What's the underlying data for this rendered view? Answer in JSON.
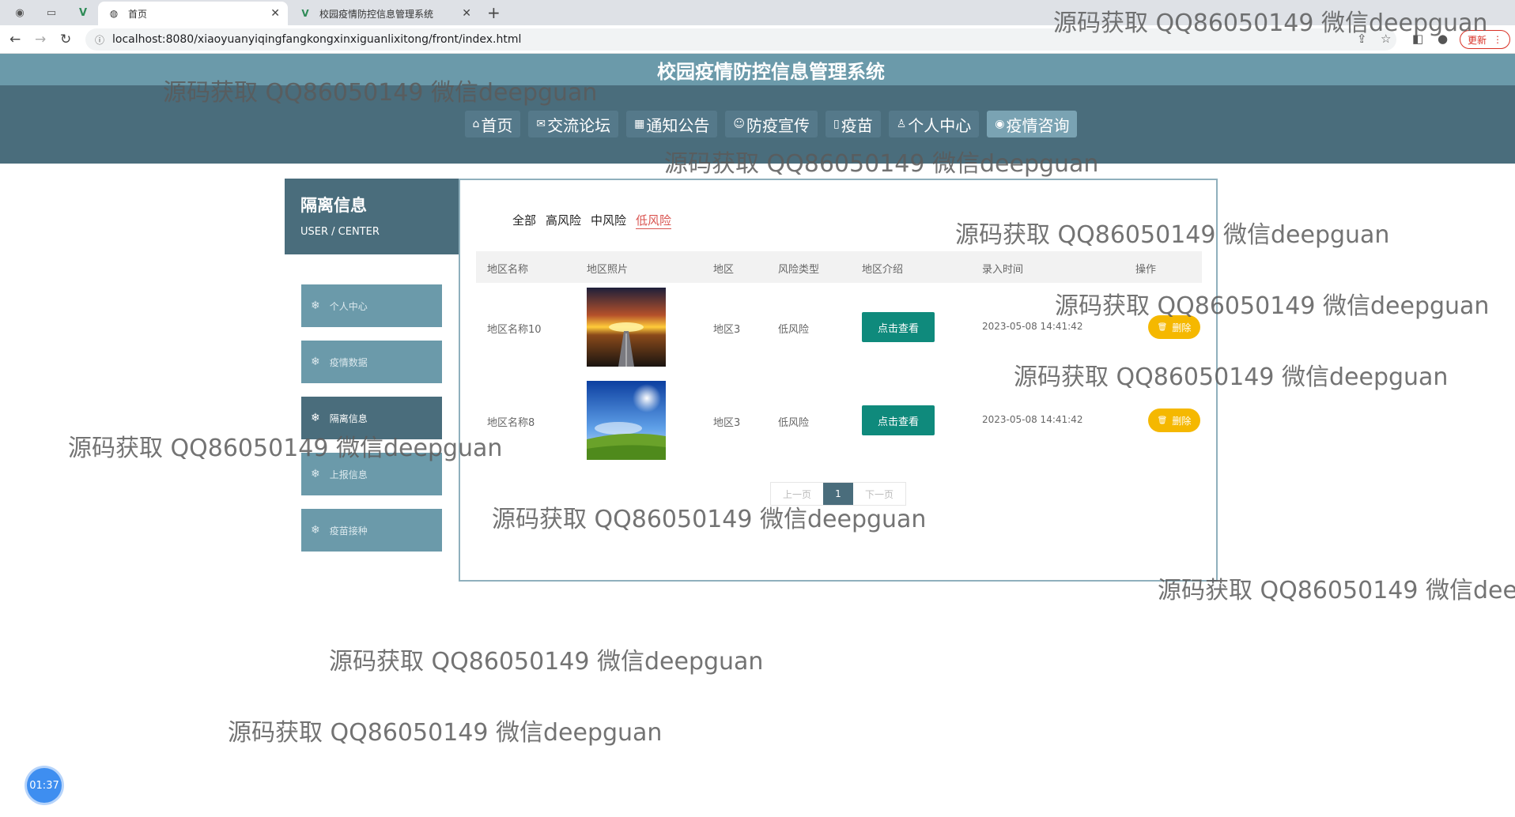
{
  "browser": {
    "tabs": [
      {
        "title": "首页"
      },
      {
        "title": "校园疫情防控信息管理系统"
      }
    ],
    "url": "localhost:8080/xiaoyuanyiqingfangkongxinxiguanlixitong/front/index.html",
    "update_label": "更新"
  },
  "site": {
    "title": "校园疫情防控信息管理系统",
    "nav": [
      {
        "label": "首页",
        "icon": "home-icon"
      },
      {
        "label": "交流论坛",
        "icon": "mail-icon"
      },
      {
        "label": "通知公告",
        "icon": "calendar-icon"
      },
      {
        "label": "防疫宣传",
        "icon": "smile-icon"
      },
      {
        "label": "疫苗",
        "icon": "document-icon"
      },
      {
        "label": "个人中心",
        "icon": "user-icon"
      },
      {
        "label": "疫情咨询",
        "icon": "globe-icon"
      }
    ],
    "active_nav": "疫情咨询"
  },
  "sidebar": {
    "heading": "隔离信息",
    "subheading": "USER / CENTER",
    "items": [
      {
        "label": "个人中心"
      },
      {
        "label": "疫情数据"
      },
      {
        "label": "隔离信息"
      },
      {
        "label": "上报信息"
      },
      {
        "label": "疫苗接种"
      }
    ],
    "active_item": "隔离信息"
  },
  "content": {
    "filters": [
      "全部",
      "高风险",
      "中风险",
      "低风险"
    ],
    "active_filter": "低风险",
    "columns": [
      "地区名称",
      "地区照片",
      "地区",
      "风险类型",
      "地区介绍",
      "录入时间",
      "操作"
    ],
    "rows": [
      {
        "name": "地区名称10",
        "photo": "sunset-road",
        "region": "地区3",
        "risk": "低风险",
        "intro_btn": "点击查看",
        "time": "2023-05-08 14:41:42",
        "delete_btn": "删除"
      },
      {
        "name": "地区名称8",
        "photo": "sunny-field",
        "region": "地区3",
        "risk": "低风险",
        "intro_btn": "点击查看",
        "time": "2023-05-08 14:41:42",
        "delete_btn": "删除"
      }
    ],
    "pager": {
      "prev": "上一页",
      "current": "1",
      "next": "下一页"
    }
  },
  "watermark": "源码获取 QQ86050149 微信deepguan",
  "timer": "01:37",
  "colors": {
    "header": "#4a6d7c",
    "header_strip": "#6b9aaa",
    "view_button": "#0f8a7c",
    "delete_button": "#f5b800",
    "active_filter": "#d9534f"
  }
}
